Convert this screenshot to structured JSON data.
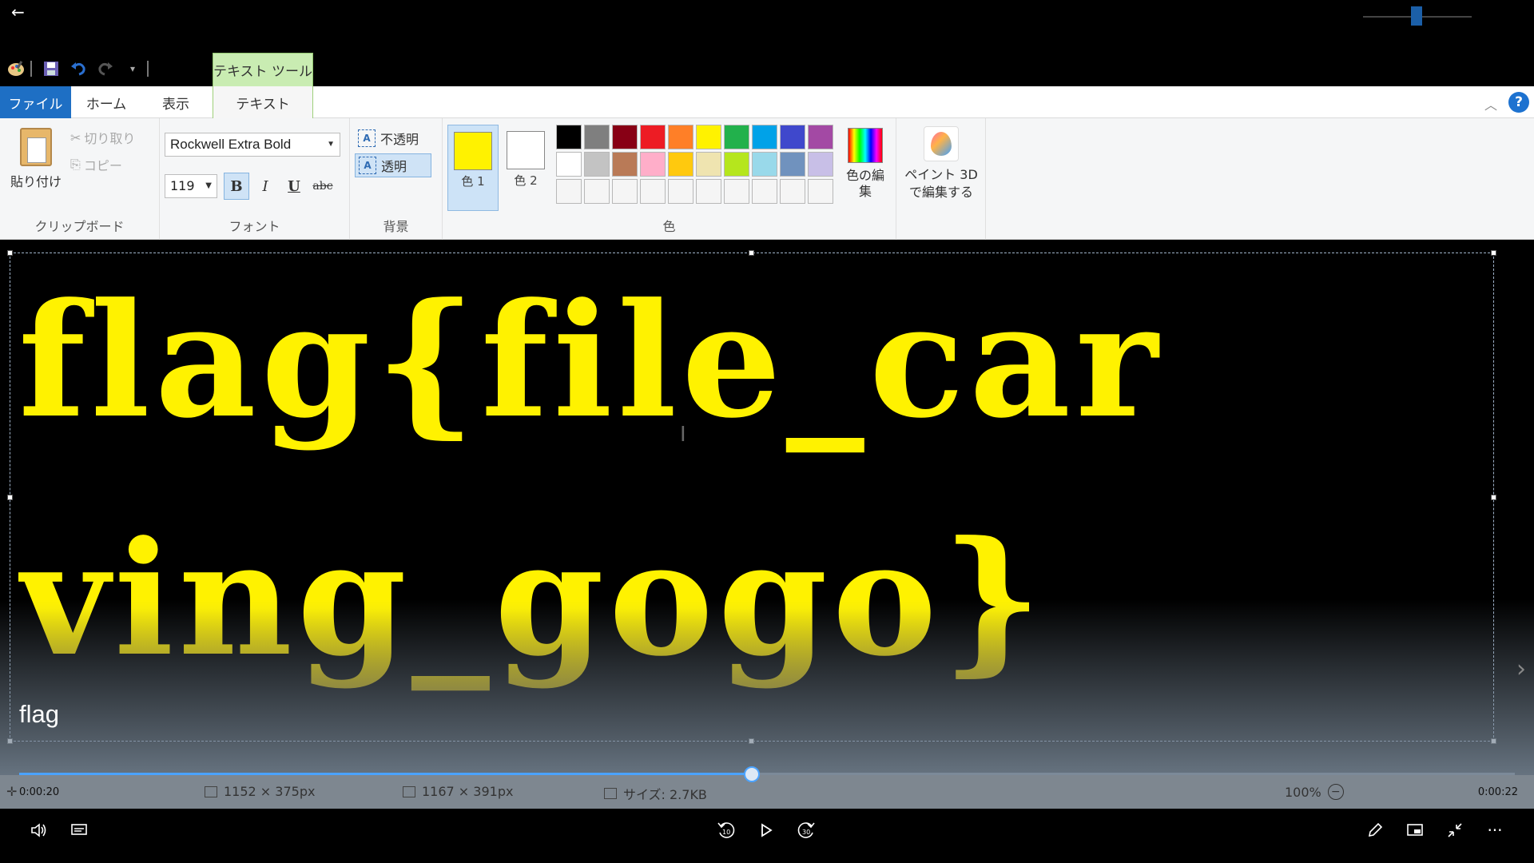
{
  "player": {
    "back_icon": "back-arrow-icon",
    "caption": "flag",
    "time_current": "0:00:20",
    "time_end": "0:00:22",
    "progress": 0.49
  },
  "paint": {
    "context_tab": "テキスト ツール",
    "tabs": [
      "ファイル",
      "ホーム",
      "表示",
      "テキスト"
    ],
    "clipboard": {
      "paste": "貼り付け",
      "cut": "切り取り",
      "copy": "コピー",
      "label": "クリップボード"
    },
    "font": {
      "name": "Rockwell Extra Bold",
      "size": "119",
      "bold": "B",
      "italic": "I",
      "underline": "U",
      "strike": "abc",
      "label": "フォント"
    },
    "background": {
      "opaque": "不透明",
      "transparent": "透明",
      "label": "背景"
    },
    "colors": {
      "color1": "色 1",
      "color2": "色 2",
      "color1_value": "#fff200",
      "color2_value": "#ffffff",
      "edit": "色の編集",
      "label": "色",
      "palette": [
        "#000000",
        "#7f7f7f",
        "#880015",
        "#ed1c24",
        "#ff7f27",
        "#fff200",
        "#22b14c",
        "#00a2e8",
        "#3f48cc",
        "#a349a4",
        "#ffffff",
        "#c3c3c3",
        "#b97a57",
        "#ffaec9",
        "#ffc90e",
        "#efe4b0",
        "#b5e61d",
        "#99d9ea",
        "#7092be",
        "#c8bfe7",
        "#f5f5f5",
        "#f5f5f5",
        "#f5f5f5",
        "#f5f5f5",
        "#f5f5f5",
        "#f5f5f5",
        "#f5f5f5",
        "#f5f5f5",
        "#f5f5f5",
        "#f5f5f5"
      ]
    },
    "paint3d": "ペイント 3D で編集する",
    "canvas_text_line1": "flag{file_car",
    "canvas_text_line2": "ving_gogo}",
    "status": {
      "selection_size": "1152 × 375px",
      "image_size": "1167 × 391px",
      "file_size": "サイズ: 2.7KB",
      "zoom": "100%"
    }
  }
}
